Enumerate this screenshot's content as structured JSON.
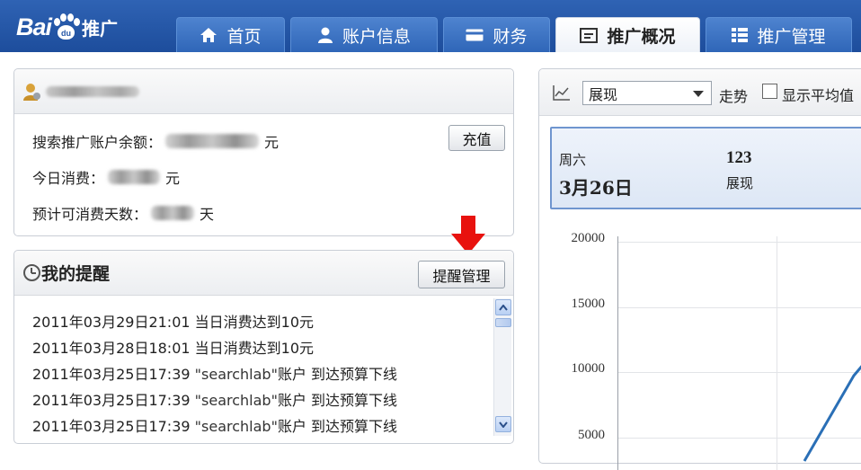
{
  "brand": {
    "logo_text": "Bai",
    "logo_paw_text": "du",
    "product": "推广",
    "blue": "#2456a6"
  },
  "nav": {
    "tabs": [
      {
        "label": "首页",
        "icon": "home-icon"
      },
      {
        "label": "账户信息",
        "icon": "user-icon"
      },
      {
        "label": "财务",
        "icon": "card-icon"
      },
      {
        "label": "推广概况",
        "icon": "overview-icon",
        "active": true
      },
      {
        "label": "推广管理",
        "icon": "grid-icon"
      }
    ]
  },
  "account": {
    "username": "searchlab",
    "balance_label": "搜索推广账户余额：",
    "balance_unit": "元",
    "today_label": "今日消费：",
    "today_unit": "元",
    "days_label": "预计可消费天数：",
    "days_unit": "天",
    "recharge_button": "充值"
  },
  "reminders": {
    "title": "我的提醒",
    "manage_button": "提醒管理",
    "items": [
      {
        "time": "2011年03月29日21:01",
        "text": "当日消费达到10元"
      },
      {
        "time": "2011年03月28日18:01",
        "text": "当日消费达到10元"
      },
      {
        "time": "2011年03月25日17:39",
        "quoted": "\"searchlab\"",
        "text": "账户 到达预算下线"
      },
      {
        "time": "2011年03月25日17:39",
        "quoted": "\"searchlab\"",
        "text": "账户 到达预算下线"
      },
      {
        "time": "2011年03月25日17:39",
        "quoted": "\"searchlab\"",
        "text": "账户 到达预算下线"
      }
    ]
  },
  "chart_panel": {
    "metric_select": "展现",
    "trend_label": "走势",
    "show_avg_label": "显示平均值",
    "show_avg_checked": false,
    "summary": {
      "weekday": "周六",
      "date": "3月26日",
      "value": "123",
      "metric": "展现"
    }
  },
  "chart_data": {
    "type": "line",
    "yticks": [
      "20000",
      "15000",
      "10000",
      "5000"
    ],
    "ylim": [
      5000,
      20000
    ],
    "grid": true,
    "series": [
      {
        "values": []
      }
    ],
    "line_color": "#2a6fb6"
  }
}
